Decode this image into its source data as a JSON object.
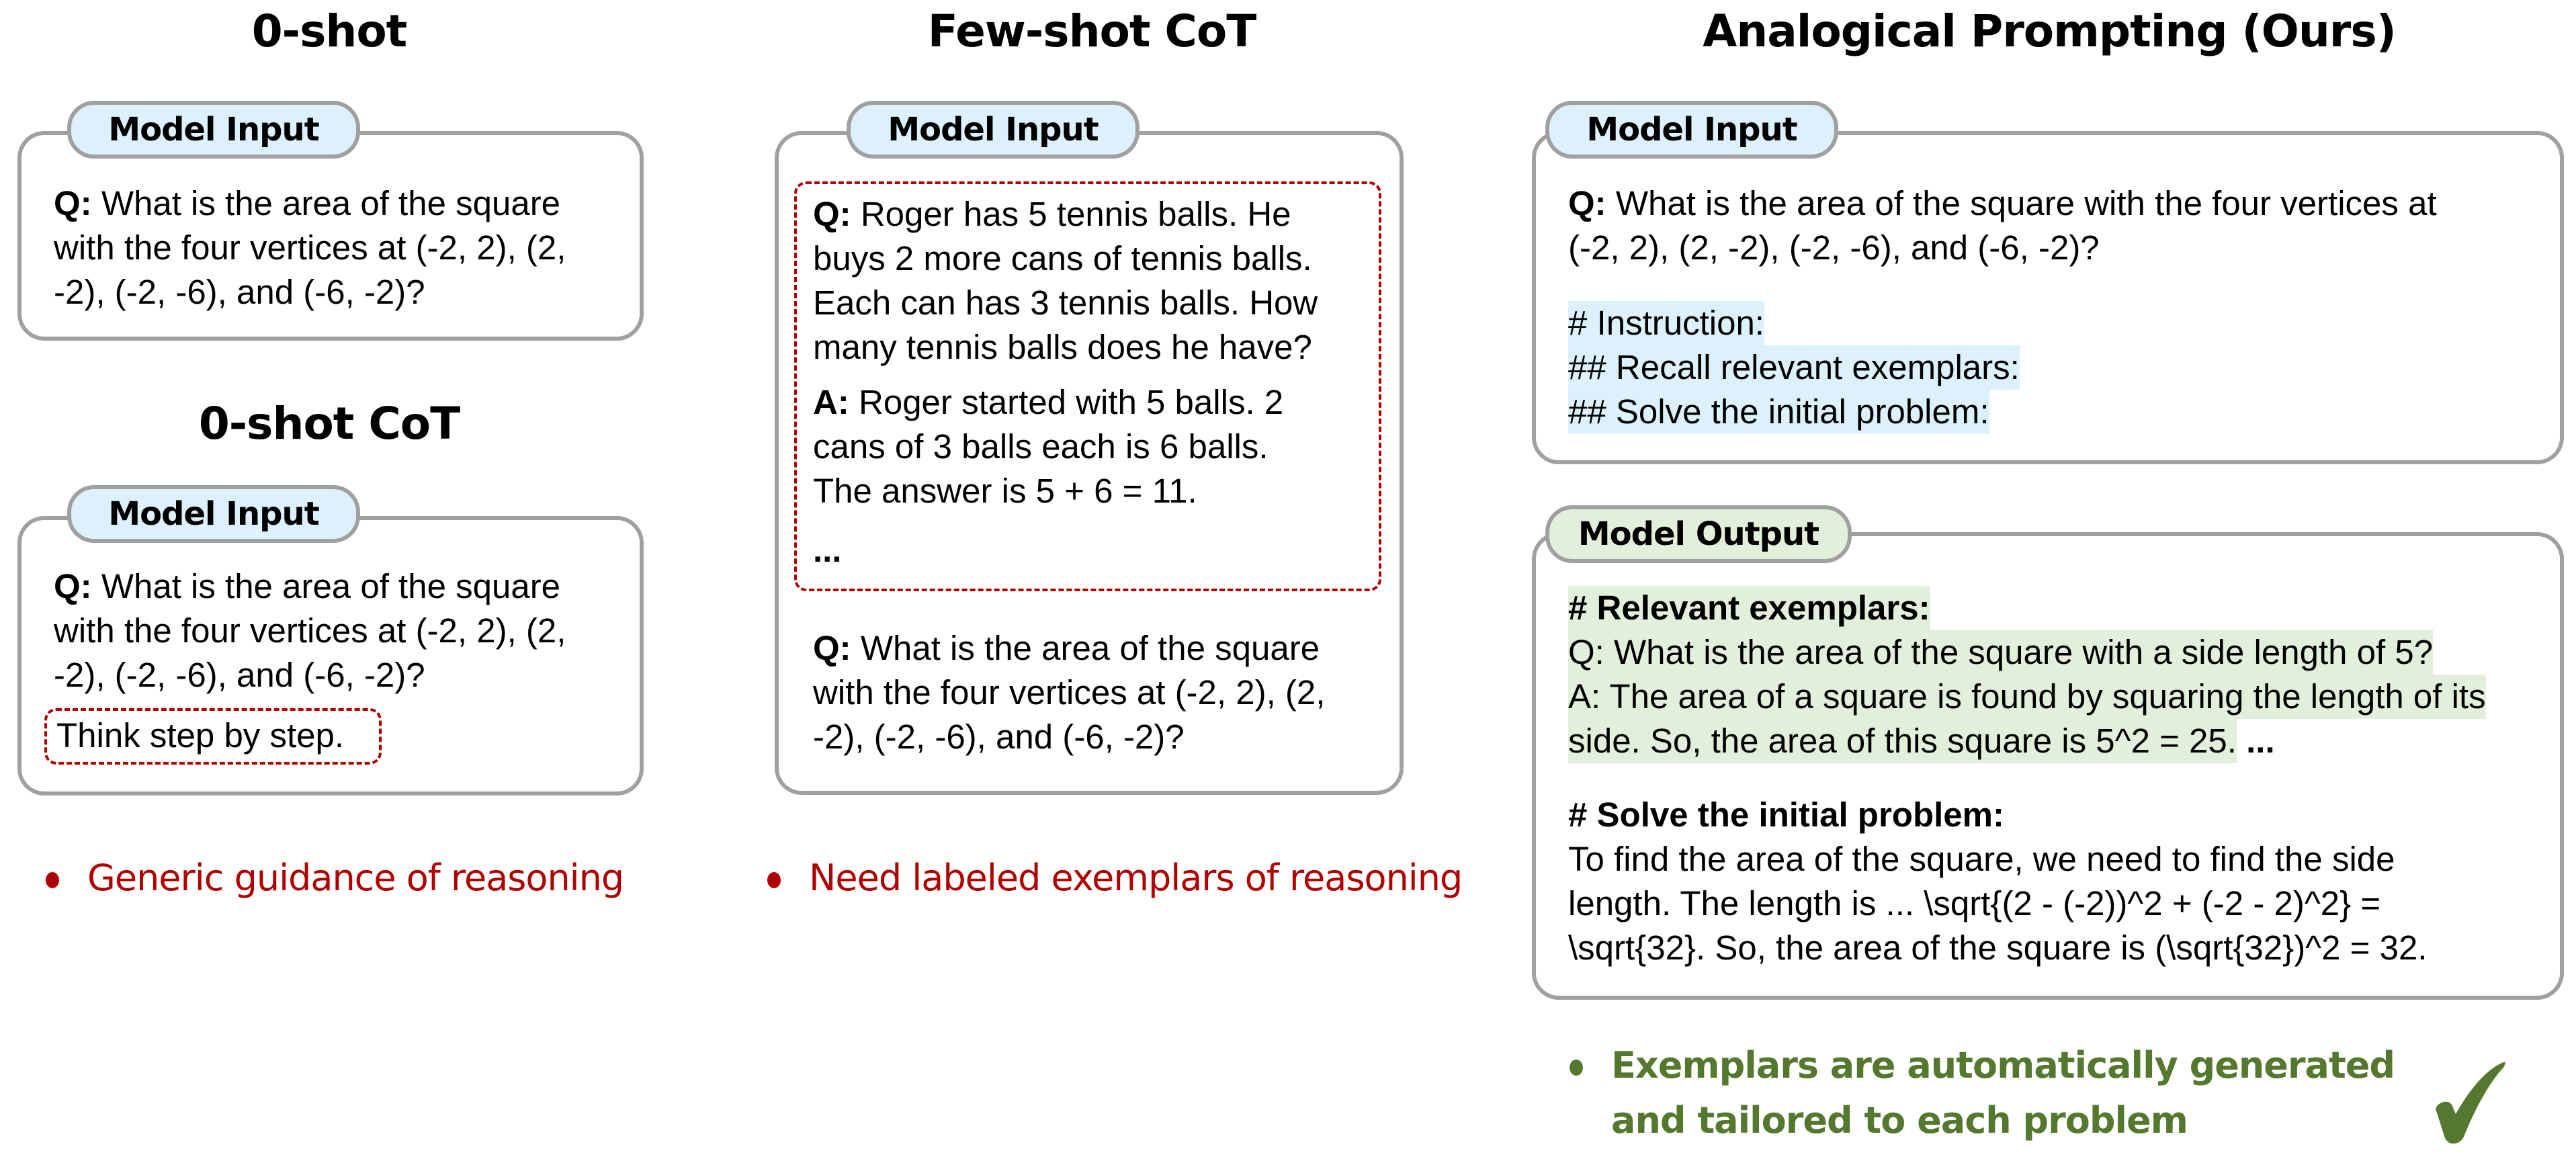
{
  "columns": {
    "zero_shot": {
      "title": "0-shot",
      "input_label": "Model Input",
      "q_prefix": "Q:",
      "question_lines": [
        " What is the area of the square",
        "with the four vertices at (-2, 2), (2,",
        "-2), (-2, -6), and (-6, -2)?"
      ]
    },
    "zero_shot_cot": {
      "title": "0-shot CoT",
      "input_label": "Model Input",
      "q_prefix": "Q:",
      "question_lines": [
        " What is the area of the square",
        "with the four vertices at (-2, 2), (2,",
        "-2), (-2, -6), and (-6, -2)?"
      ],
      "trigger": "Think step by step.",
      "note": "Generic guidance of reasoning"
    },
    "few_shot_cot": {
      "title": "Few-shot CoT",
      "input_label": "Model Input",
      "exemplar_q_prefix": "Q:",
      "exemplar_q_lines": [
        " Roger has 5 tennis balls. He",
        "buys 2 more cans of tennis balls.",
        "Each can has 3 tennis balls. How",
        "many tennis balls does he have?"
      ],
      "exemplar_a_prefix": "A:",
      "exemplar_a_lines": [
        " Roger started with 5 balls. 2",
        "cans of 3 balls each is 6 balls.",
        "The answer is 5 + 6 = 11."
      ],
      "ellipsis": "...",
      "q_prefix": "Q:",
      "question_lines": [
        " What is the area of the square",
        "with the four vertices at (-2, 2), (2,",
        "-2), (-2, -6), and (-6, -2)?"
      ],
      "note": "Need labeled exemplars of reasoning"
    },
    "analogical": {
      "title": "Analogical Prompting (Ours)",
      "input_label": "Model Input",
      "q_prefix": "Q:",
      "question_lines": [
        " What is the area of the square with the four vertices at",
        "(-2, 2), (2, -2), (-2, -6), and (-6, -2)?"
      ],
      "instruction_lines": [
        "# Instruction:",
        "## Recall relevant exemplars:",
        "## Solve the initial problem:"
      ],
      "output_label": "Model Output",
      "exemplars_heading": "# Relevant exemplars:",
      "exemplar_lines": [
        "Q: What is the area of the square with a side length of 5?",
        "A: The area of a square is found by squaring the length of its",
        "side. So, the area of this square is 5^2 = 25."
      ],
      "exemplar_ellipsis": "...",
      "solve_heading": "# Solve the initial problem:",
      "solve_lines": [
        "To find the area of the square, we need to find the side",
        "length. The length is ... \\sqrt{(2 - (-2))^2 + (-2 - 2)^2} =",
        "\\sqrt{32}. So, the area of the square is (\\sqrt{32})^2 = 32."
      ],
      "note_parts": [
        "Exemplars are ",
        "automatically",
        " generated",
        "and ",
        "tailored",
        " to each problem"
      ],
      "check_icon": "check-mark-icon"
    }
  },
  "colors": {
    "input_pill": "#dcf1fb",
    "output_pill": "#e2efda",
    "negative": "#b00000",
    "positive": "#54782e",
    "border": "#a0a0a0"
  }
}
